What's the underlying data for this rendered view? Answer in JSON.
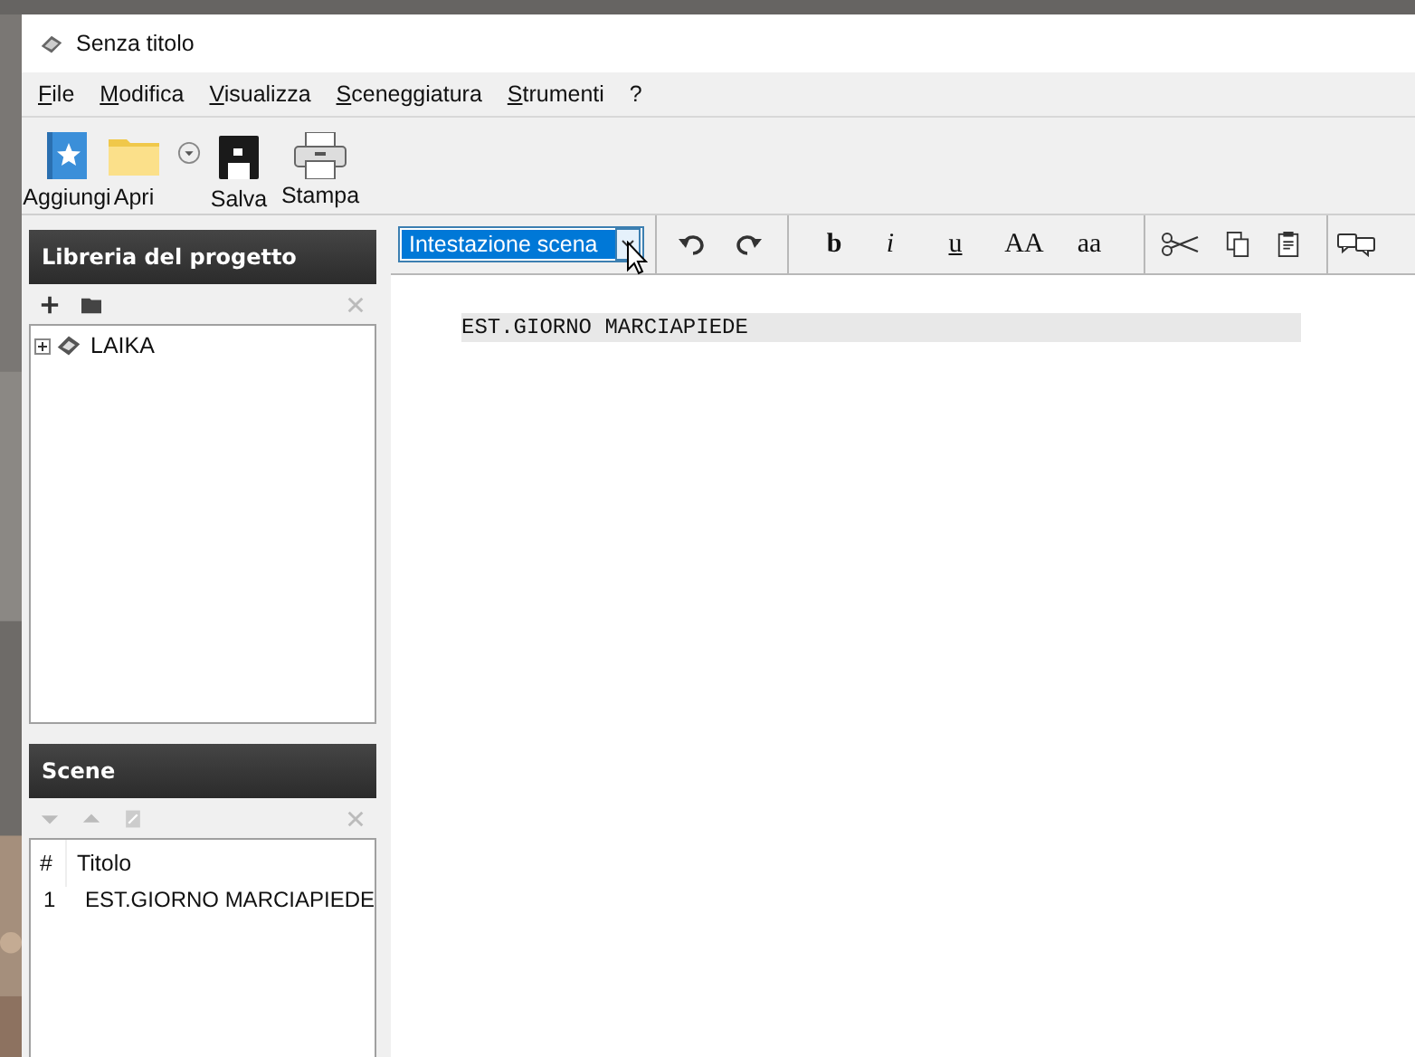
{
  "window": {
    "title": "Senza titolo"
  },
  "menu": [
    {
      "label": "File"
    },
    {
      "label": "Modifica"
    },
    {
      "label": "Visualizza"
    },
    {
      "label": "Sceneggiatura"
    },
    {
      "label": "Strumenti"
    },
    {
      "label": "?"
    }
  ],
  "toolbar": [
    {
      "kind": "add",
      "label": "Aggiungi"
    },
    {
      "kind": "open",
      "label": "Apri"
    },
    {
      "kind": "dropdown"
    },
    {
      "kind": "save",
      "label": "Salva"
    },
    {
      "kind": "print",
      "label": "Stampa"
    }
  ],
  "library": {
    "title": "Libreria del progetto",
    "tree": [
      {
        "label": "LAIKA",
        "expanded": false
      }
    ]
  },
  "scenes": {
    "title": "Scene",
    "columns": [
      "#",
      "Titolo"
    ],
    "rows": [
      {
        "cells": [
          "1",
          "EST.GIORNO MARCIAPIEDE"
        ]
      }
    ]
  },
  "editor": {
    "style_select": {
      "value": "Intestazione scena"
    },
    "format_buttons": [
      {
        "kind": "bold",
        "label": "b"
      },
      {
        "kind": "italic",
        "label": "i"
      },
      {
        "kind": "underline",
        "label": "u"
      },
      {
        "kind": "upper",
        "label": "AA"
      },
      {
        "kind": "lower",
        "label": "aa"
      }
    ],
    "lines": [
      {
        "kind": "scene-heading",
        "text": "EST.GIORNO MARCIAPIEDE"
      }
    ]
  }
}
